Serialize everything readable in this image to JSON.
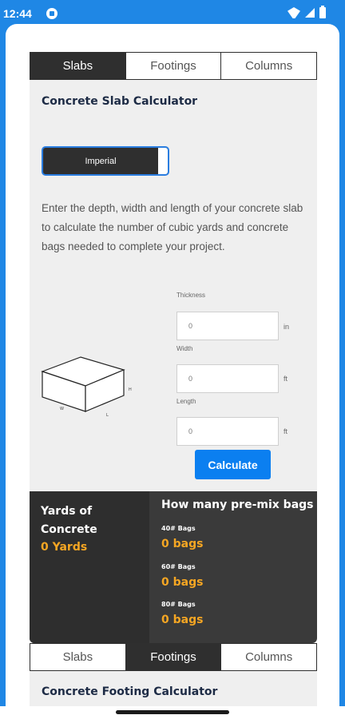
{
  "status": {
    "time": "12:44"
  },
  "calculator1": {
    "tabs": [
      {
        "label": "Slabs",
        "active": true
      },
      {
        "label": "Footings",
        "active": false
      },
      {
        "label": "Columns",
        "active": false
      }
    ],
    "title": "Concrete Slab Calculator",
    "unit_toggle": "Imperial",
    "description": "Enter the depth, width and length of your concrete slab to calculate the number of cubic yards and concrete bags needed to complete your project.",
    "fields": [
      {
        "label": "Thickness",
        "value": "0",
        "unit": "in"
      },
      {
        "label": "Width",
        "value": "0",
        "unit": "ft"
      },
      {
        "label": "Length",
        "value": "0",
        "unit": "ft"
      }
    ],
    "figure_labels": {
      "h": "H",
      "w": "W",
      "l": "L"
    },
    "calculate_label": "Calculate",
    "results": {
      "yards_label": "Yards of Concrete",
      "yards_value": "0 Yards",
      "bags_title": "How many pre-mix bags",
      "bags": [
        {
          "label": "40# Bags",
          "value": "0 bags"
        },
        {
          "label": "60# Bags",
          "value": "0 bags"
        },
        {
          "label": "80# Bags",
          "value": "0 bags"
        }
      ]
    }
  },
  "calculator2": {
    "tabs": [
      {
        "label": "Slabs",
        "active": false
      },
      {
        "label": "Footings",
        "active": true
      },
      {
        "label": "Columns",
        "active": false
      }
    ],
    "title": "Concrete Footing Calculator"
  },
  "colors": {
    "status_bar": "#1f87e5",
    "dark_panel": "#2f2f2f",
    "accent_orange": "#f5a623",
    "button_blue": "#0b7ff0"
  }
}
